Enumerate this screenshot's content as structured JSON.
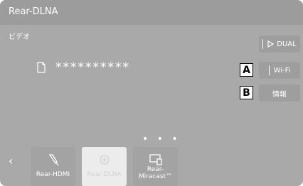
{
  "header": {
    "title": "Rear-DLNA"
  },
  "main": {
    "category_label": "ビデオ",
    "file_name": "**********",
    "file_icon": "document-icon",
    "page_dots": "• • •"
  },
  "side_buttons": {
    "dual": "DUAL",
    "wifi": "Wi-Fi",
    "info": "情報"
  },
  "callouts": {
    "a": "A",
    "b": "B"
  },
  "source_bar": {
    "back_icon": "chevron-left-icon",
    "back_glyph": "‹",
    "items": [
      {
        "label": "Rear-HDMI",
        "icon": "hdmi-cable-icon",
        "selected": false
      },
      {
        "label": "Rear-DLNA",
        "icon": "dlna-icon",
        "selected": true
      },
      {
        "label_line1": "Rear-",
        "label_line2": "Miracast™",
        "icon": "screen-cast-icon",
        "selected": false
      }
    ]
  },
  "colors": {
    "screen_bg": "#a9a9a9",
    "header_bg": "#9c9c9c",
    "selected_tile": "#ececec",
    "text": "#ffffff"
  }
}
